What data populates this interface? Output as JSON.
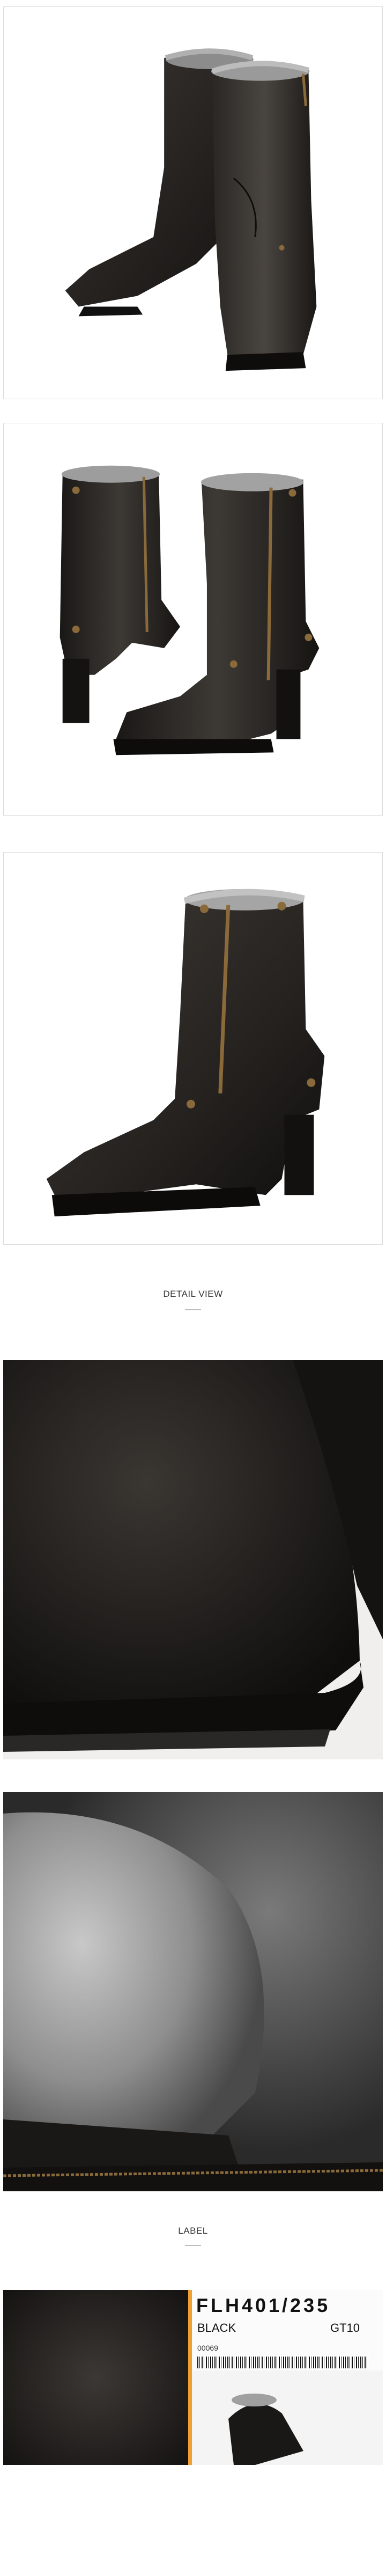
{
  "sections": {
    "detail_title": "DETAIL VIEW",
    "label_title": "LABEL"
  },
  "product_label": {
    "model_code": "FLH401/235",
    "color": "BLACK",
    "size_code": "GT10",
    "barcode_number": "00069"
  },
  "colors": {
    "leather": "#1c1a18",
    "fur": "#9a9a9a",
    "zipper": "#8a6a3a",
    "label_orange": "#f0a030"
  }
}
